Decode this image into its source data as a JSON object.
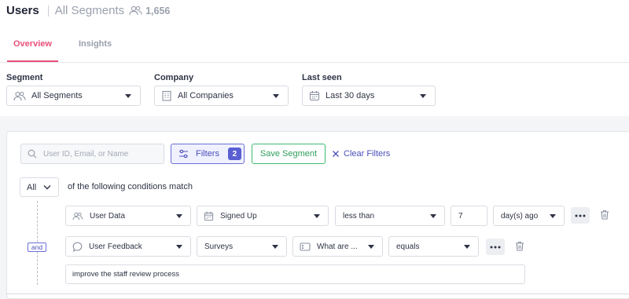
{
  "header": {
    "title": "Users",
    "subtitle": "All Segments",
    "count": "1,656",
    "count_icon": "users-icon"
  },
  "tabs": [
    {
      "label": "Overview",
      "active": true
    },
    {
      "label": "Insights",
      "active": false
    }
  ],
  "filters_bar": {
    "segment": {
      "label": "Segment",
      "value": "All Segments",
      "icon": "users-icon"
    },
    "company": {
      "label": "Company",
      "value": "All Companies",
      "icon": "building-icon"
    },
    "last_seen": {
      "label": "Last seen",
      "value": "Last 30 days",
      "icon": "calendar-icon"
    }
  },
  "toolbar": {
    "search_placeholder": "User ID, Email, or Name",
    "filters_label": "Filters",
    "filters_count": "2",
    "save_label": "Save Segment",
    "clear_label": "Clear Filters"
  },
  "conditions": {
    "match_mode": "All",
    "match_text": "of the following conditions match",
    "joiner": "and",
    "rows": [
      {
        "source": "User Data",
        "attribute": "Signed Up",
        "operator": "less than",
        "value": "7",
        "unit": "day(s) ago"
      },
      {
        "source": "User Feedback",
        "type": "Surveys",
        "question": "What are ...",
        "operator": "equals",
        "text_value": "improve the staff review process"
      }
    ]
  },
  "colors": {
    "accent_pink": "#e7507a",
    "accent_purple": "#5a5fd2",
    "accent_green": "#3dba6f"
  }
}
